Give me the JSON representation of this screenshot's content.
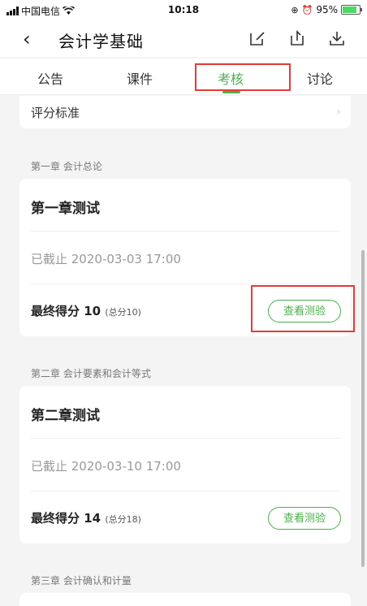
{
  "status_bar": {
    "carrier": "中国电信",
    "time": "10:18",
    "battery": "95%"
  },
  "header": {
    "title": "会计学基础"
  },
  "tabs": [
    {
      "label": "公告"
    },
    {
      "label": "课件"
    },
    {
      "label": "考核",
      "active": true
    },
    {
      "label": "讨论"
    }
  ],
  "grading": {
    "label": "评分标准"
  },
  "chapters": [
    {
      "section": "第一章 会计总论",
      "quiz_title": "第一章测试",
      "deadline": "已截止 2020-03-03 17:00",
      "score_label": "最终得分",
      "score": "10",
      "total": "(总分10)",
      "button": "查看测验"
    },
    {
      "section": "第二章 会计要素和会计等式",
      "quiz_title": "第二章测试",
      "deadline": "已截止 2020-03-10 17:00",
      "score_label": "最终得分",
      "score": "14",
      "total": "(总分18)",
      "button": "查看测验"
    },
    {
      "section": "第三章 会计确认和计量"
    }
  ],
  "colors": {
    "accent": "#4cae4c",
    "highlight": "#e53935"
  }
}
